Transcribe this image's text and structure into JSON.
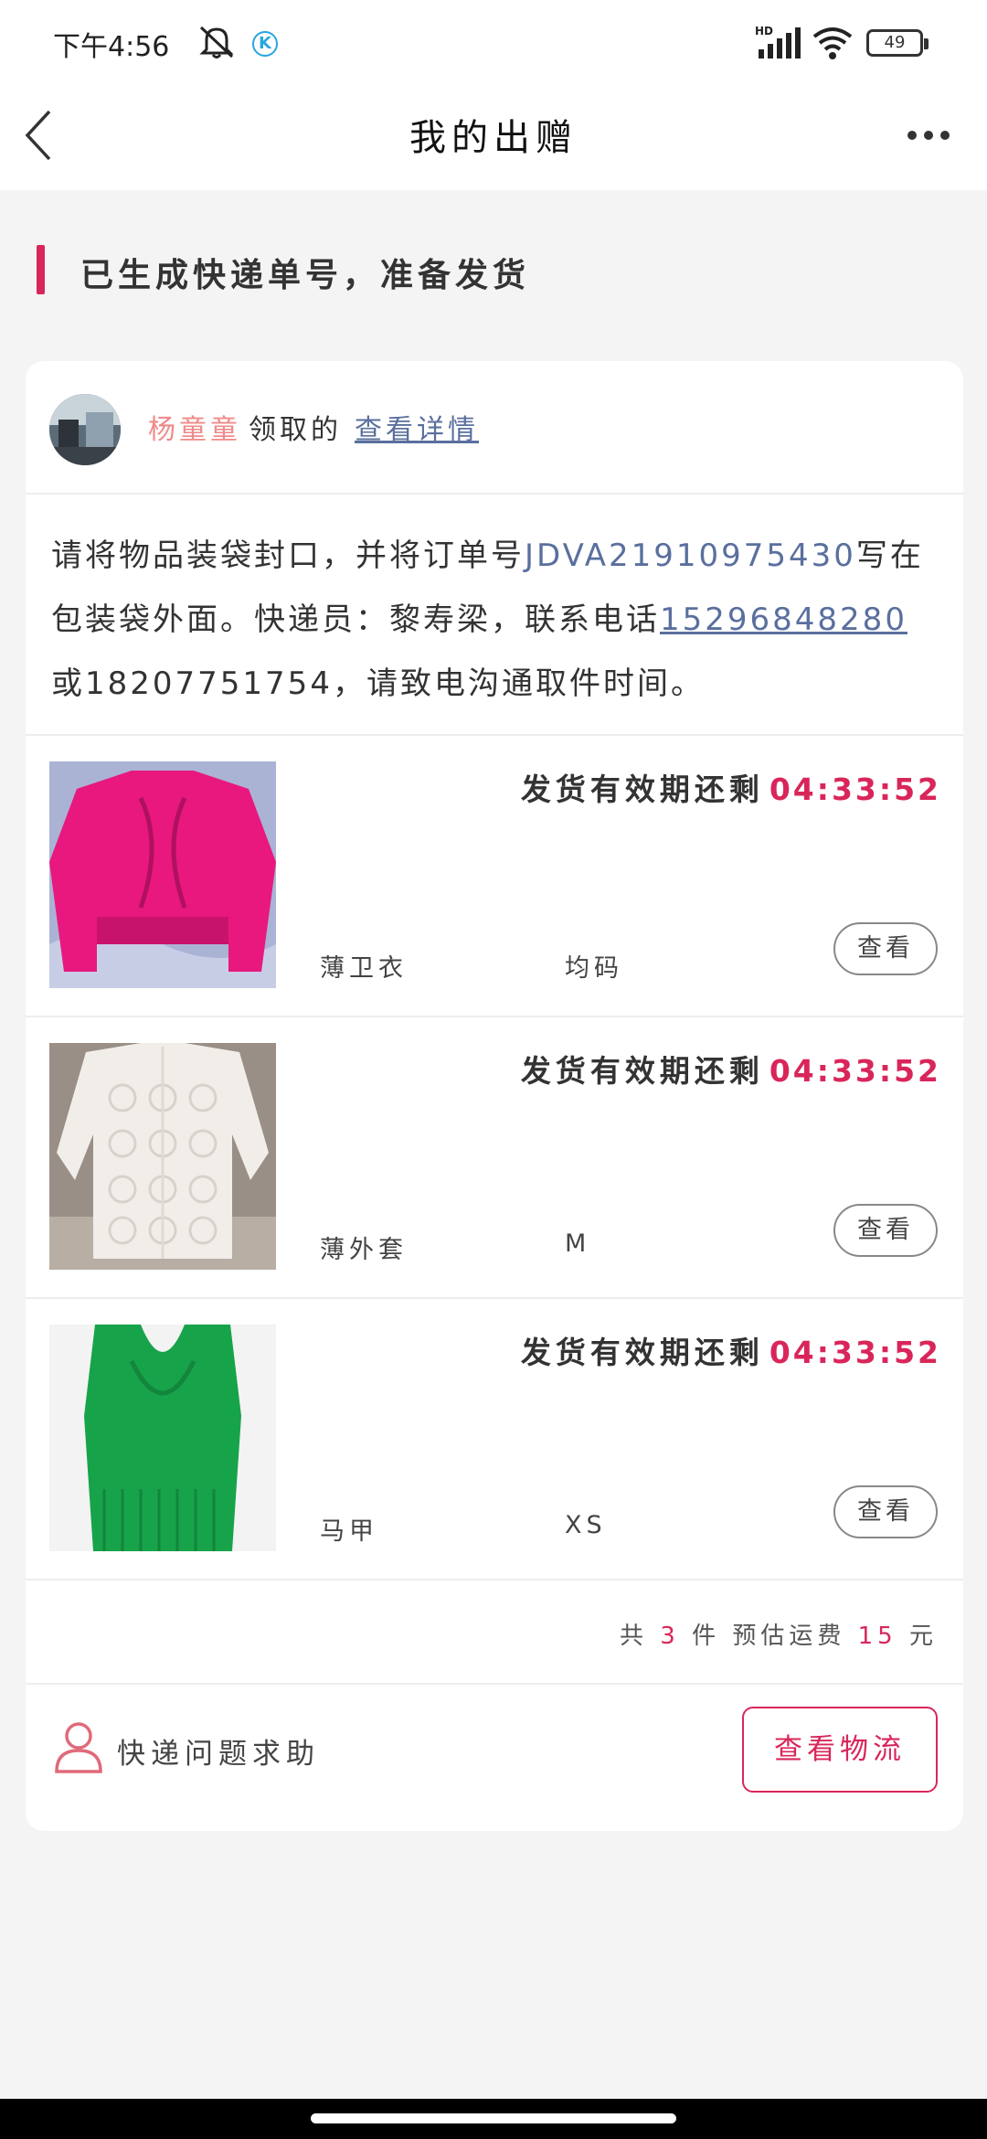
{
  "status_bar": {
    "time": "下午4:56",
    "network": "HD",
    "battery": "49",
    "icons": [
      "mute-icon",
      "k-app-icon",
      "signal-icon",
      "wifi-icon",
      "battery-icon"
    ]
  },
  "nav": {
    "title": "我的出赠",
    "icons": [
      "back-arrow-icon",
      "more-dots-icon"
    ]
  },
  "banner": {
    "text": "已生成快递单号，准备发货",
    "accent_color": "#d9265a"
  },
  "donor": {
    "name": "杨童童",
    "suffix": "领取的",
    "link": "查看详情"
  },
  "instructions": {
    "part1": "请将物品装袋封口，并将订单号",
    "order_no": "JDVA21910975430",
    "part2": "写在包装袋外面。快递员：黎寿梁，联系电话",
    "phone1": "15296848280",
    "part3": "或18207751754，请致电沟通取件时间。"
  },
  "items": [
    {
      "deadline_label": "发货有效期还剩",
      "time_left": "04:33:52",
      "name": "薄卫衣",
      "size": "均码",
      "button": "查看",
      "image": "pink-sweater"
    },
    {
      "deadline_label": "发货有效期还剩",
      "time_left": "04:33:52",
      "name": "薄外套",
      "size": "M",
      "button": "查看",
      "image": "white-lace-jacket"
    },
    {
      "deadline_label": "发货有效期还剩",
      "time_left": "04:33:52",
      "name": "马甲",
      "size": "XS",
      "button": "查看",
      "image": "green-vest"
    }
  ],
  "summary": {
    "prefix": "共",
    "count": "3",
    "middle": "件 预估运费",
    "fee": "15",
    "suffix": "元"
  },
  "footer": {
    "help_text": "快递问题求助",
    "logistics_button": "查看物流",
    "icons": [
      "user-icon"
    ]
  }
}
